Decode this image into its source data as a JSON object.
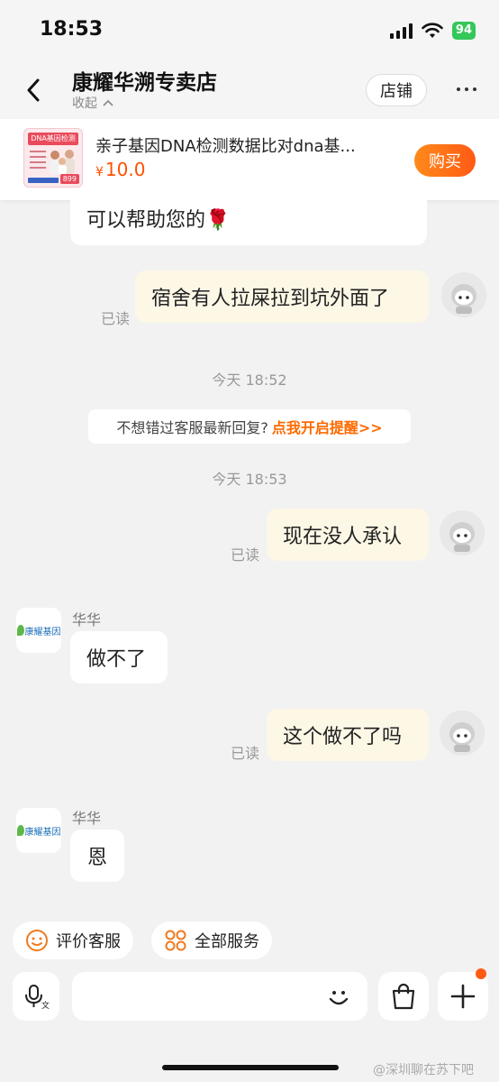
{
  "status_bar": {
    "time": "18:53",
    "battery": "94"
  },
  "header": {
    "title": "康耀华溯专卖店",
    "collapse_label": "收起",
    "shop_button": "店铺"
  },
  "product": {
    "thumb_title": "DNA基因检测",
    "thumb_price": "899",
    "name": "亲子基因DNA检测数据比对dna基...",
    "currency": "¥",
    "price": "10.0",
    "buy_button": "购买"
  },
  "messages": {
    "m1_text": "可以帮助您的🌹",
    "m2_text": "宿舍有人拉屎拉到坑外面了",
    "m2_status": "已读",
    "time1": "今天 18:52",
    "notice_text": "不想错过客服最新回复?",
    "notice_link": "点我开启提醒>>",
    "time2": "今天 18:53",
    "m3_text": "现在没人承认",
    "m3_status": "已读",
    "m4_sender": "华华",
    "m4_text": "做不了",
    "m5_text": "这个做不了吗",
    "m5_status": "已读",
    "m6_sender": "华华",
    "m6_text": "恩",
    "shop_avatar_label": "康耀基因"
  },
  "quick_actions": {
    "rate_label": "评价客服",
    "services_label": "全部服务"
  },
  "input": {
    "placeholder": ""
  },
  "watermark": "@深圳聊在苏下吧",
  "colors": {
    "accent": "#ff5000",
    "bubble_self": "#fdf7e6",
    "background": "#f2f2f2"
  }
}
